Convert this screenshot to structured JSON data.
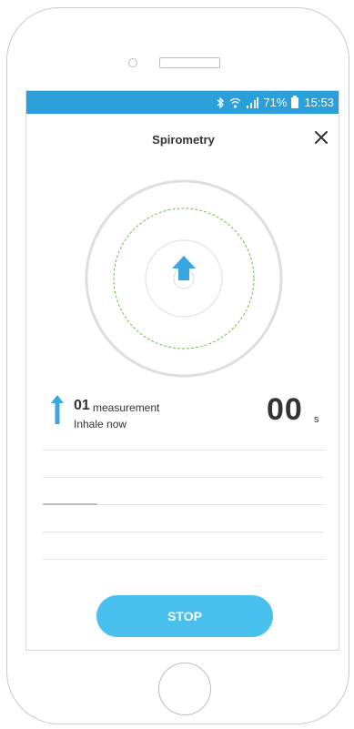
{
  "statusbar": {
    "icons": [
      "bluetooth-icon",
      "wifi-icon",
      "signal-icon",
      "battery-icon"
    ],
    "battery_percent": "71%",
    "time": "15:53"
  },
  "header": {
    "title": "Spirometry",
    "close_icon": "close-icon"
  },
  "breathing_indicator": {
    "icon": "arrow-up-icon",
    "accent_color": "#3aa6e0",
    "target_ring_color": "#6cc04a"
  },
  "measurement": {
    "number": "01",
    "label": "measurement",
    "status": "Inhale now",
    "icon": "arrow-up-icon"
  },
  "timer": {
    "value": "00",
    "unit": "s"
  },
  "actions": {
    "stop_label": "STOP"
  },
  "colors": {
    "statusbar": "#2a9fd9",
    "button": "#4ac0ee",
    "text": "#333333"
  }
}
